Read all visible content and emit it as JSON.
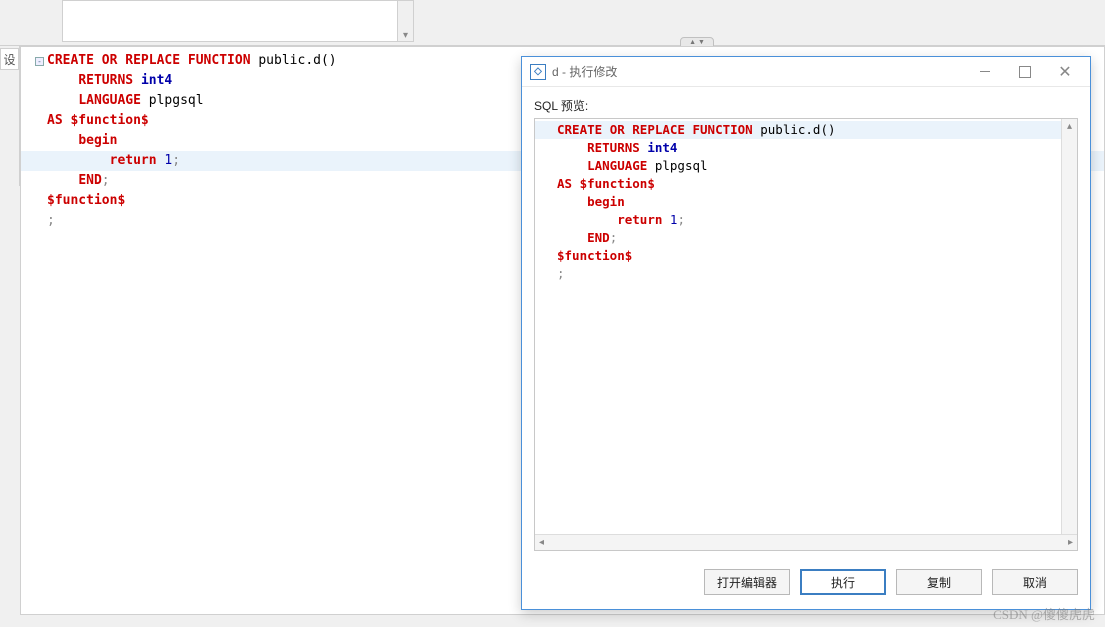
{
  "left_tab_label": "设",
  "main_editor": {
    "code_html": "<span class='kw'>CREATE</span> <span class='kw'>OR</span> <span class='kw'>REPLACE</span> <span class='kw'>FUNCTION</span> <span class='plain'>public.d()</span>\n    <span class='kw'>RETURNS</span> <span class='kw2'>int4</span>\n    <span class='kw'>LANGUAGE</span> <span class='plain'>plpgsql</span>\n<span class='kw'>AS</span> <span class='dollar'>$function$</span>\n    <span class='fn'>begin</span>\n        <span class='fn'>return</span> <span class='num'>1</span><span class='punct'>;</span>\n    <span class='fn'>END</span><span class='punct'>;</span>\n<span class='dollar'>$function$</span>\n<span class='punct'>;</span>",
    "highlight_line_index": 5
  },
  "dialog": {
    "title": "d - 执行修改",
    "icon_glyph": "◇",
    "preview_label": "SQL 预览:",
    "code_html": "<span class='kw'>CREATE</span> <span class='kw'>OR</span> <span class='kw'>REPLACE</span> <span class='kw'>FUNCTION</span> <span class='plain'>public.d()</span>\n    <span class='kw'>RETURNS</span> <span class='kw2'>int4</span>\n    <span class='kw'>LANGUAGE</span> <span class='plain'>plpgsql</span>\n<span class='kw'>AS</span> <span class='dollar'>$function$</span>\n    <span class='fn'>begin</span>\n        <span class='fn'>return</span> <span class='num'>1</span><span class='punct'>;</span>\n    <span class='fn'>END</span><span class='punct'>;</span>\n<span class='dollar'>$function$</span>\n<span class='punct'>;</span>",
    "highlight_line_index": 0,
    "buttons": {
      "open_editor": "打开编辑器",
      "execute": "执行",
      "copy": "复制",
      "cancel": "取消"
    }
  },
  "watermark": "CSDN @傻傻虎虎"
}
